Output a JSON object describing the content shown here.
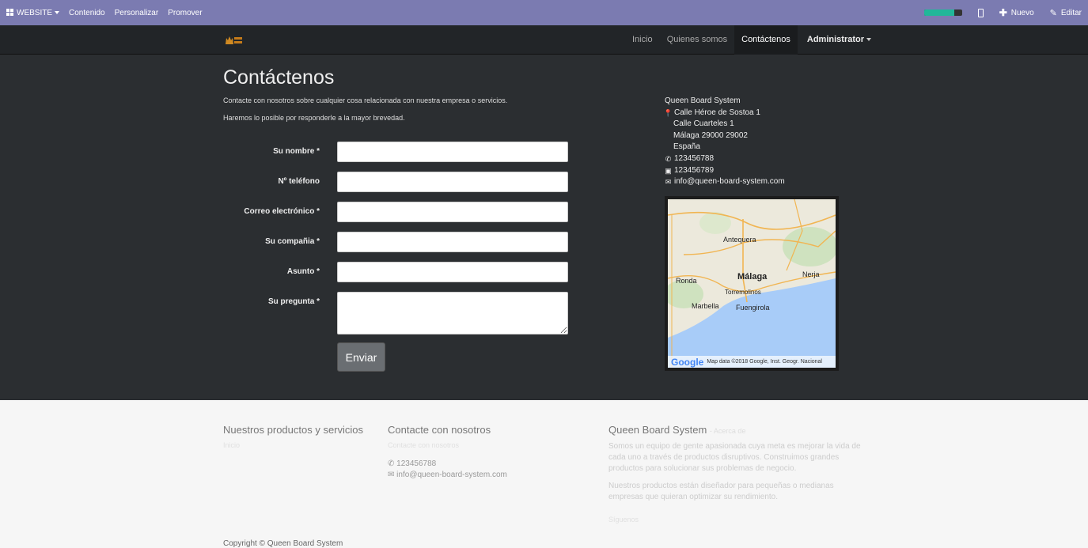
{
  "admin_bar": {
    "website_label": "WEBSITE",
    "menu": [
      "Contenido",
      "Personalizar",
      "Promover"
    ],
    "progress": 0.8,
    "new_label": "Nuevo",
    "edit_label": "Editar",
    "accent": "#7b7bb1",
    "progress_color": "#21b799"
  },
  "navbar": {
    "items": [
      {
        "label": "Inicio"
      },
      {
        "label": "Quienes somos"
      },
      {
        "label": "Contáctenos"
      },
      {
        "label": "Administrator"
      }
    ],
    "active": "Contáctenos"
  },
  "contact": {
    "title": "Contáctenos",
    "intro_1": "Contacte con nosotros sobre cualquier cosa relacionada con nuestra empresa o servicios.",
    "intro_2": "Haremos lo posible por responderle a la mayor brevedad.",
    "fields": {
      "name": "Su nombre *",
      "phone": "Nº teléfono",
      "email": "Correo electrónico *",
      "company": "Su compañia *",
      "subject": "Asunto *",
      "question": "Su pregunta *"
    },
    "submit": "Enviar"
  },
  "address": {
    "company": "Queen Board System",
    "street_1": "Calle Héroe de Sostoa 1",
    "street_2": "Calle Cuarteles 1",
    "city": "Málaga 29000 29002",
    "country": "España",
    "phone": "123456788",
    "fax": "123456789",
    "email": "info@queen-board-system.com"
  },
  "map": {
    "labels": {
      "antequera": "Antequera",
      "malaga": "Málaga",
      "nerja": "Nerja",
      "ronda": "Ronda",
      "torremolinos": "Torremolinos",
      "marbella": "Marbella",
      "fuengirola": "Fuengirola"
    },
    "google": "Google",
    "credit": "Map data ©2018 Google, Inst. Geogr. Nacional"
  },
  "footer": {
    "products_title": "Nuestros productos y servicios",
    "products_link": "Inicio",
    "contact_title": "Contacte con nosotros",
    "contact_link": "Contacte con nosotros",
    "phone": "123456788",
    "email": "info@queen-board-system.com",
    "about_title": "Queen Board System",
    "about_suffix": "- Acerca de",
    "about_p1": "Somos un equipo de gente apasionada cuya meta es mejorar la vida de cada uno a través de productos disruptivos. Construimos grandes productos para solucionar sus problemas de negocio.",
    "about_p2": "Nuestros productos están diseñador para pequeñas o medianas empresas que quieran optimizar su rendimiento.",
    "social": "Síguenos",
    "copyright": "Copyright © Queen Board System"
  }
}
